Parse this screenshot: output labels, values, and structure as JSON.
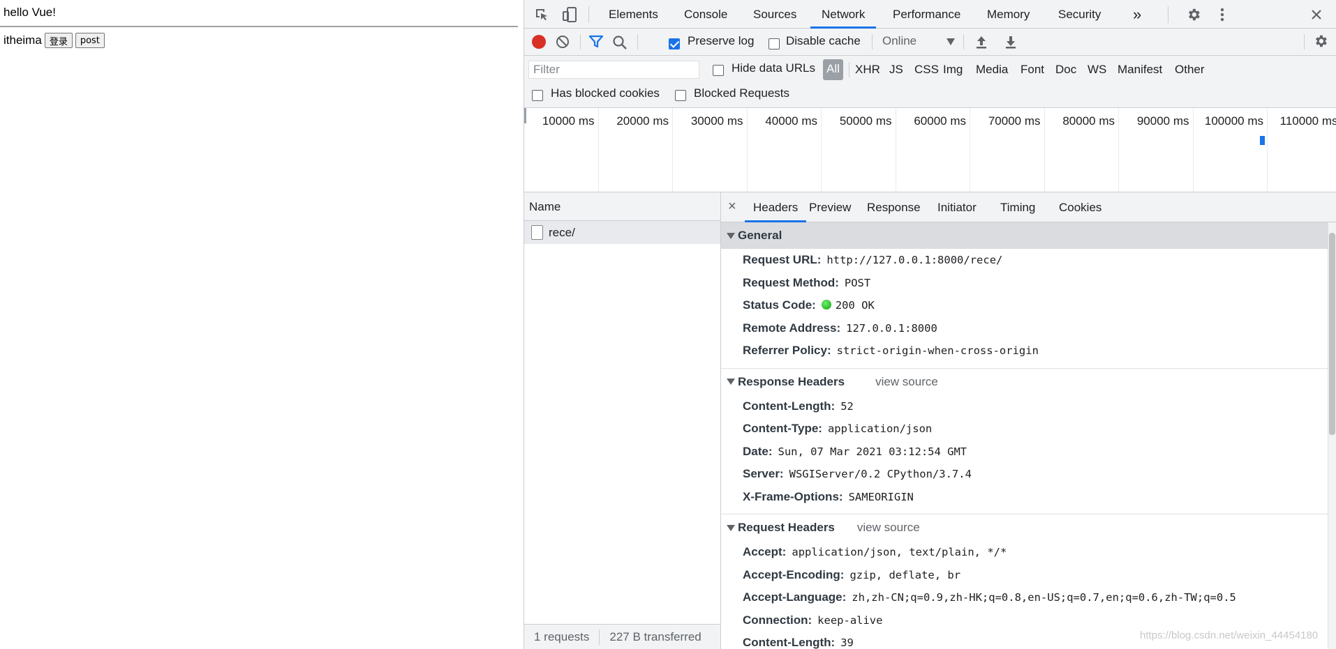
{
  "page": {
    "heading": "hello Vue!",
    "label": "itheima",
    "buttons": [
      "登录",
      "post"
    ]
  },
  "devtools": {
    "tabs": [
      "Elements",
      "Console",
      "Sources",
      "Network",
      "Performance",
      "Memory",
      "Security"
    ],
    "active_tab": "Network",
    "more": "»",
    "toolbar": {
      "preserve_log": "Preserve log",
      "preserve_log_checked": true,
      "disable_cache": "Disable cache",
      "disable_cache_checked": false,
      "throttle": "Online"
    },
    "filter": {
      "placeholder": "Filter",
      "hide_data_urls": "Hide data URLs",
      "types": [
        "All",
        "XHR",
        "JS",
        "CSS",
        "Img",
        "Media",
        "Font",
        "Doc",
        "WS",
        "Manifest",
        "Other"
      ],
      "selected_type": "All",
      "has_blocked_cookies": "Has blocked cookies",
      "blocked_requests": "Blocked Requests"
    },
    "timeline": {
      "labels": [
        "10000 ms",
        "20000 ms",
        "30000 ms",
        "40000 ms",
        "50000 ms",
        "60000 ms",
        "70000 ms",
        "80000 ms",
        "90000 ms",
        "100000 ms",
        "110000 ms"
      ]
    },
    "name_column": {
      "header": "Name",
      "requests": [
        "rece/"
      ]
    },
    "status": {
      "requests": "1 requests",
      "transferred": "227 B transferred"
    },
    "details": {
      "close": "×",
      "tabs": [
        "Headers",
        "Preview",
        "Response",
        "Initiator",
        "Timing",
        "Cookies"
      ],
      "active_tab": "Headers",
      "sections": [
        {
          "title": "General",
          "view_source": "",
          "rows": [
            {
              "key": "Request URL:",
              "value": "http://127.0.0.1:8000/rece/"
            },
            {
              "key": "Request Method:",
              "value": "POST"
            },
            {
              "key": "Status Code:",
              "value": "200 OK",
              "status_dot": true
            },
            {
              "key": "Remote Address:",
              "value": "127.0.0.1:8000"
            },
            {
              "key": "Referrer Policy:",
              "value": "strict-origin-when-cross-origin"
            }
          ]
        },
        {
          "title": "Response Headers",
          "view_source": "view source",
          "rows": [
            {
              "key": "Content-Length:",
              "value": "52"
            },
            {
              "key": "Content-Type:",
              "value": "application/json"
            },
            {
              "key": "Date:",
              "value": "Sun, 07 Mar 2021 03:12:54 GMT"
            },
            {
              "key": "Server:",
              "value": "WSGIServer/0.2 CPython/3.7.4"
            },
            {
              "key": "X-Frame-Options:",
              "value": "SAMEORIGIN"
            }
          ]
        },
        {
          "title": "Request Headers",
          "view_source": "view source",
          "rows": [
            {
              "key": "Accept:",
              "value": "application/json, text/plain, */*"
            },
            {
              "key": "Accept-Encoding:",
              "value": "gzip, deflate, br"
            },
            {
              "key": "Accept-Language:",
              "value": "zh,zh-CN;q=0.9,zh-HK;q=0.8,en-US;q=0.7,en;q=0.6,zh-TW;q=0.5"
            },
            {
              "key": "Connection:",
              "value": "keep-alive"
            },
            {
              "key": "Content-Length:",
              "value": "39"
            }
          ]
        }
      ]
    }
  },
  "watermark": "https://blog.csdn.net/weixin_44454180"
}
